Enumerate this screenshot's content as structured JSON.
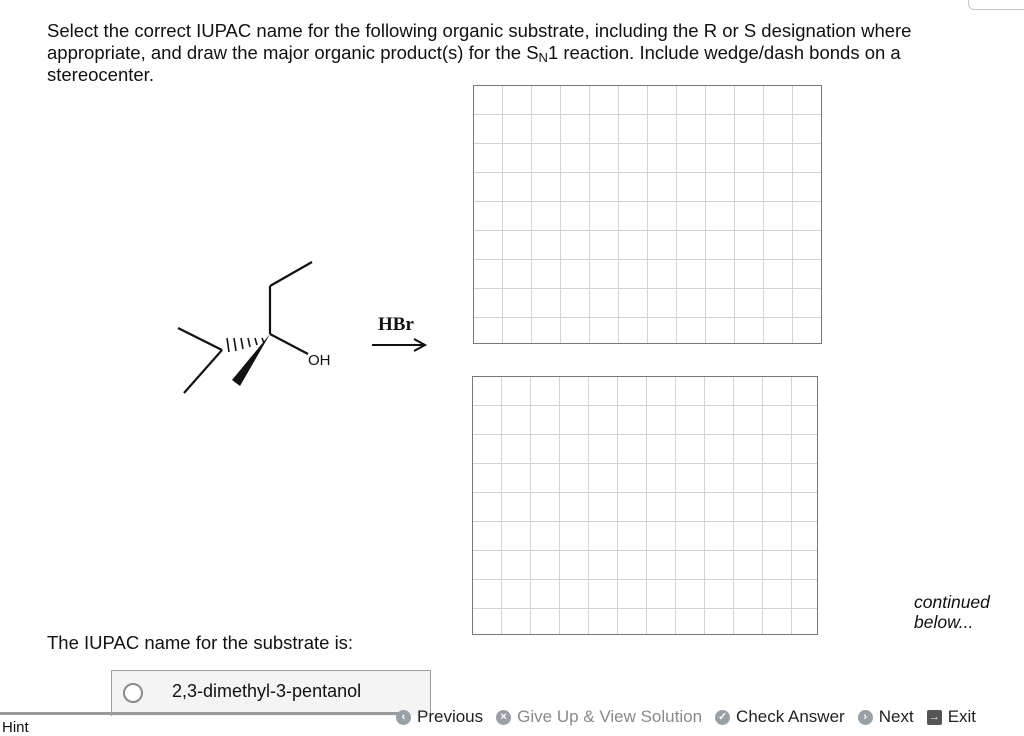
{
  "question": {
    "text_before_sub": "Select the correct IUPAC name for the following organic substrate, including the R or S designation where appropriate, and draw the major organic product(s) for the S",
    "sub": "N",
    "text_after_sub": "1 reaction. Include wedge/dash bonds on a stereocenter."
  },
  "molecule": {
    "oh_label": "OH"
  },
  "reaction": {
    "reagent": "HBr"
  },
  "continued_text": "continued below...",
  "iupac": {
    "prompt": "The IUPAC name for the substrate is:",
    "option_label": "2,3-dimethyl-3-pentanol"
  },
  "hint": {
    "label": "Hint"
  },
  "nav": {
    "previous": "Previous",
    "give_up": "Give Up & View Solution",
    "check": "Check Answer",
    "next": "Next",
    "exit": "Exit"
  }
}
